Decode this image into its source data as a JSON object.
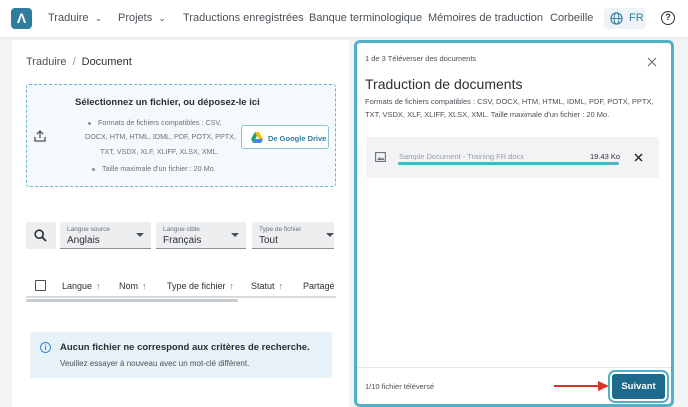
{
  "topbar": {
    "logo": "Λ",
    "nav": [
      {
        "label": "Traduire",
        "has_menu": true
      },
      {
        "label": "Projets",
        "has_menu": true
      },
      {
        "label": "Traductions enregistrées",
        "has_menu": false
      },
      {
        "label": "Banque terminologique",
        "has_menu": false
      },
      {
        "label": "Mémoires de traduction",
        "has_menu": false
      },
      {
        "label": "Corbeille",
        "has_menu": false
      }
    ],
    "language": "FR",
    "help_glyph": "?"
  },
  "breadcrumb": {
    "parent": "Traduire",
    "separator": "/",
    "current": "Document"
  },
  "dropzone": {
    "title": "Sélectionnez un fichier, ou déposez-le ici",
    "formats_lines": [
      "Formats de fichiers compatibles : CSV,",
      "DOCX, HTM, HTML, IDML, PDF, POTX, PPTX,",
      "TXT, VSDX, XLF, XLIFF, XLSX, XML."
    ],
    "max_size": "Taille maximale d'un fichier : 20 Mo.",
    "gdrive_label": "De Google Drive"
  },
  "filters": {
    "source": {
      "label": "Langue source",
      "value": "Anglais"
    },
    "target": {
      "label": "Langue cible",
      "value": "Français"
    },
    "type": {
      "label": "Type de fichier",
      "value": "Tout"
    }
  },
  "table": {
    "columns": [
      {
        "label": "Langue",
        "sort": "↑"
      },
      {
        "label": "Nom",
        "sort": "↑"
      },
      {
        "label": "Type de fichier",
        "sort": "↑"
      },
      {
        "label": "Statut",
        "sort": "↑"
      },
      {
        "label": "Partagé",
        "sort": ""
      }
    ]
  },
  "empty_state": {
    "icon": "i",
    "title": "Aucun fichier ne correspond aux critères de recherche.",
    "subtitle": "Veuillez essayer à nouveau avec un mot-clé différent."
  },
  "modal": {
    "step": "1 de 3 Téléverser des documents",
    "title": "Traduction de documents",
    "description": "Formats de fichiers compatibles : CSV, DOCX, HTM, HTML, IDML, PDF, POTX, PPTX, TXT, VSDX, XLF, XLIFF, XLSX, XML. Taille maximale d'un fichier : 20 Mo.",
    "file": {
      "name": "Sample Document - Training FR.docx",
      "size": "19.43 Ko",
      "progress_percent": 100
    },
    "upload_count": "1/10 fichier téléversé",
    "next_label": "Suivant"
  },
  "colors": {
    "accent": "#4fb0c6",
    "primary_button": "#1d6a8c",
    "annotation_arrow": "#d9342b",
    "info_bg": "#e6f1f8"
  }
}
